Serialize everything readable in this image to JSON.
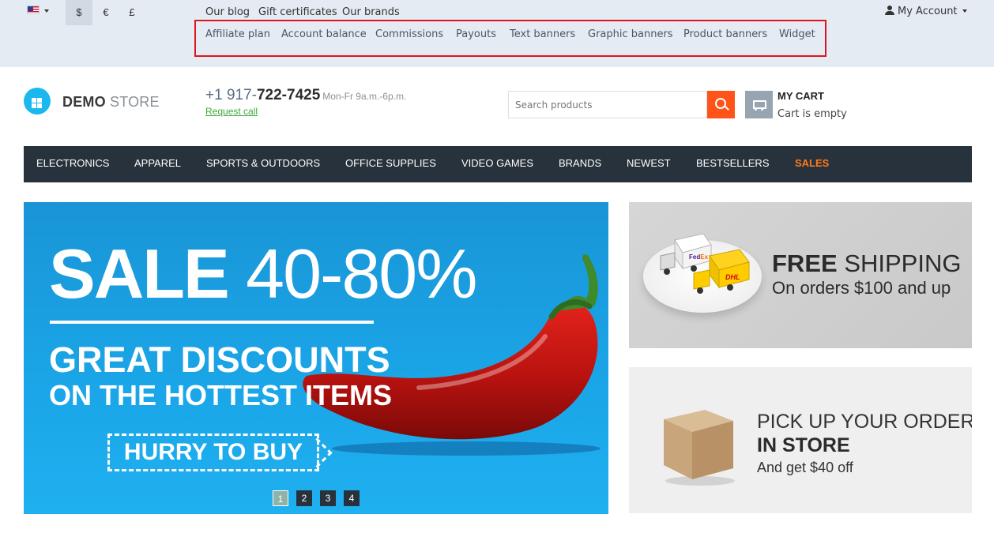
{
  "topbar": {
    "currencies": [
      "$",
      "€",
      "£"
    ],
    "links": [
      "Our blog",
      "Gift certificates",
      "Our brands"
    ],
    "affiliate_links": [
      "Affiliate plan",
      "Account balance",
      "Commissions",
      "Payouts",
      "Text banners",
      "Graphic banners",
      "Product banners",
      "Widget"
    ],
    "account_label": "My Account",
    "highlight_color": "#e0141e"
  },
  "header": {
    "logo_bold": "DEMO",
    "logo_light": "STORE",
    "phone_prefix": "+1 917-",
    "phone_main": "722-7425",
    "phone_hours": "Mon-Fr 9a.m.-6p.m.",
    "request_call": "Request call",
    "search_placeholder": "Search products",
    "cart_title": "MY CART",
    "cart_status": "Cart is empty"
  },
  "nav": {
    "items": [
      "ELECTRONICS",
      "APPAREL",
      "SPORTS & OUTDOORS",
      "OFFICE SUPPLIES",
      "VIDEO GAMES",
      "BRANDS",
      "NEWEST",
      "BESTSELLERS",
      "SALES"
    ],
    "accent": "#ff7a1a"
  },
  "hero": {
    "sale_word": "SALE",
    "sale_range": "40-80%",
    "headline": "GREAT DISCOUNTS",
    "subheadline": "ON THE HOTTEST ITEMS",
    "cta": "HURRY TO BUY",
    "pages": [
      "1",
      "2",
      "3",
      "4"
    ],
    "active_page": "1"
  },
  "shipping_banner": {
    "title_bold": "FREE",
    "title_light": "SHIPPING",
    "subtitle": "On orders $100 and up"
  },
  "pickup_banner": {
    "title": "PICK UP YOUR ORDER",
    "title_bold": "IN STORE",
    "subtitle": "And get $40 off"
  }
}
